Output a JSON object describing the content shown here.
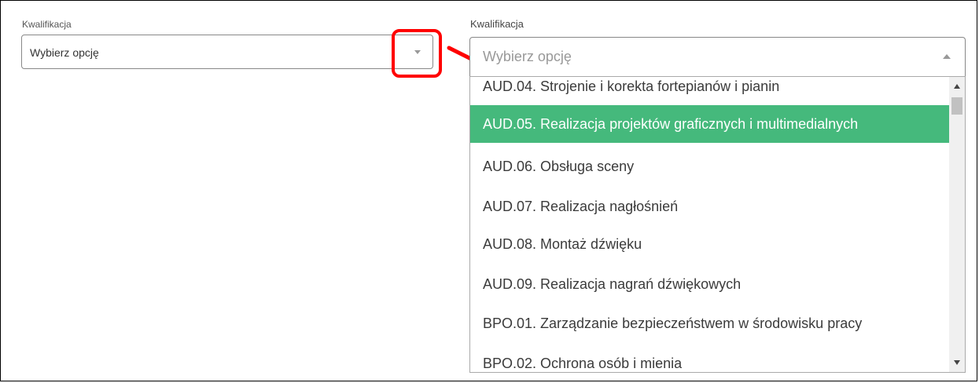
{
  "left_field": {
    "label": "Kwalifikacja",
    "value": "Wybierz opcję",
    "icon": "chevron-down-icon"
  },
  "right_field": {
    "label": "Kwalifikacja",
    "placeholder": "Wybierz opcję",
    "icon": "chevron-up-icon"
  },
  "options": [
    {
      "label": "AUD.04. Strojenie i korekta fortepianów i pianin",
      "selected": false
    },
    {
      "label": "AUD.05. Realizacja projektów graficznych i multimedialnych",
      "selected": true
    },
    {
      "label": "AUD.06. Obsługa sceny",
      "selected": false
    },
    {
      "label": "AUD.07. Realizacja nagłośnień",
      "selected": false
    },
    {
      "label": "AUD.08. Montaż dźwięku",
      "selected": false
    },
    {
      "label": "AUD.09. Realizacja nagrań dźwiękowych",
      "selected": false
    },
    {
      "label": "BPO.01. Zarządzanie bezpieczeństwem w środowisku pracy",
      "selected": false
    },
    {
      "label": "BPO.02. Ochrona osób i mienia",
      "selected": false
    }
  ],
  "colors": {
    "selected_bg": "#45b97c",
    "annotation": "#ff0000"
  }
}
